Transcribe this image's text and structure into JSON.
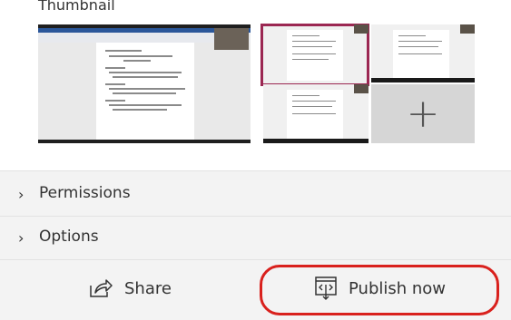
{
  "thumbnail": {
    "label": "Thumbnail"
  },
  "sections": [
    {
      "label": "Permissions"
    },
    {
      "label": "Options"
    }
  ],
  "footer": {
    "share_label": "Share",
    "publish_label": "Publish now"
  },
  "colors": {
    "selection": "#9b2752",
    "annotation": "#d9211d",
    "text": "#333333"
  }
}
